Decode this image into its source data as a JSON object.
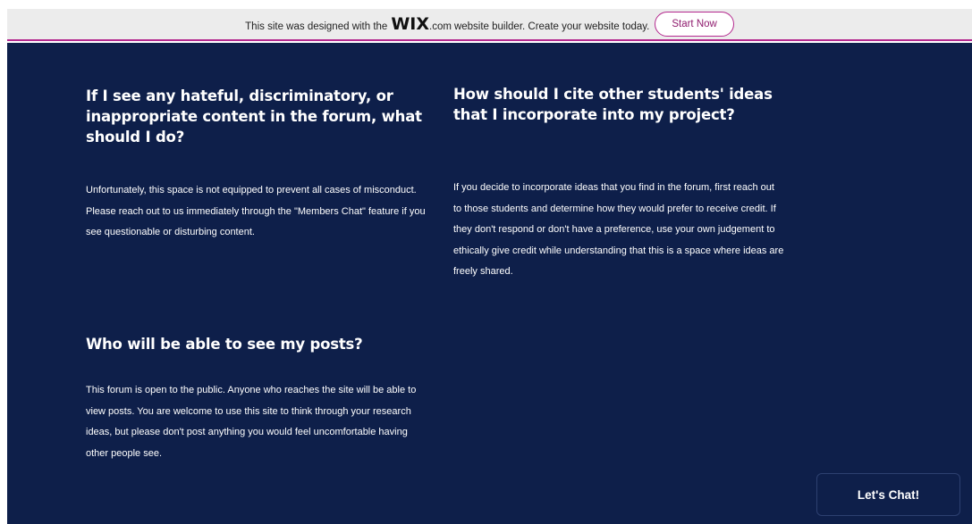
{
  "banner": {
    "text_before_logo": "This site was designed with the",
    "logo_text": "WIX",
    "logo_suffix": ".com",
    "text_after_logo": "website builder. Create your website today.",
    "cta_label": "Start Now"
  },
  "faq": [
    {
      "question": "If I see any hateful, discriminatory, or inappropriate content in the forum, what should I do?",
      "answer": "Unfortunately, this space is not equipped to prevent all cases of misconduct. Please reach out to us immediately through the \"Members Chat\" feature if you see questionable or disturbing content."
    },
    {
      "question": "How should I cite other students' ideas that I incorporate into my project?",
      "answer": "If you decide to incorporate ideas that you find in the forum, first reach out to those students and determine how they would prefer to receive credit. If they don't respond or don't have a preference, use your own judgement to ethically give credit while understanding that this is a space where ideas are freely shared."
    },
    {
      "question": "Who will be able to see my posts?",
      "answer": "This forum is open to the public. Anyone who reaches the site will be able to view posts. You are welcome to use this site to think through your research ideas, but please don't post anything you would feel uncomfortable having other people see."
    }
  ],
  "chat": {
    "label": "Let's Chat!"
  },
  "colors": {
    "background": "#0e1f4a",
    "banner_bg": "#ececec",
    "accent": "#b4298e",
    "text": "#ffffff"
  }
}
